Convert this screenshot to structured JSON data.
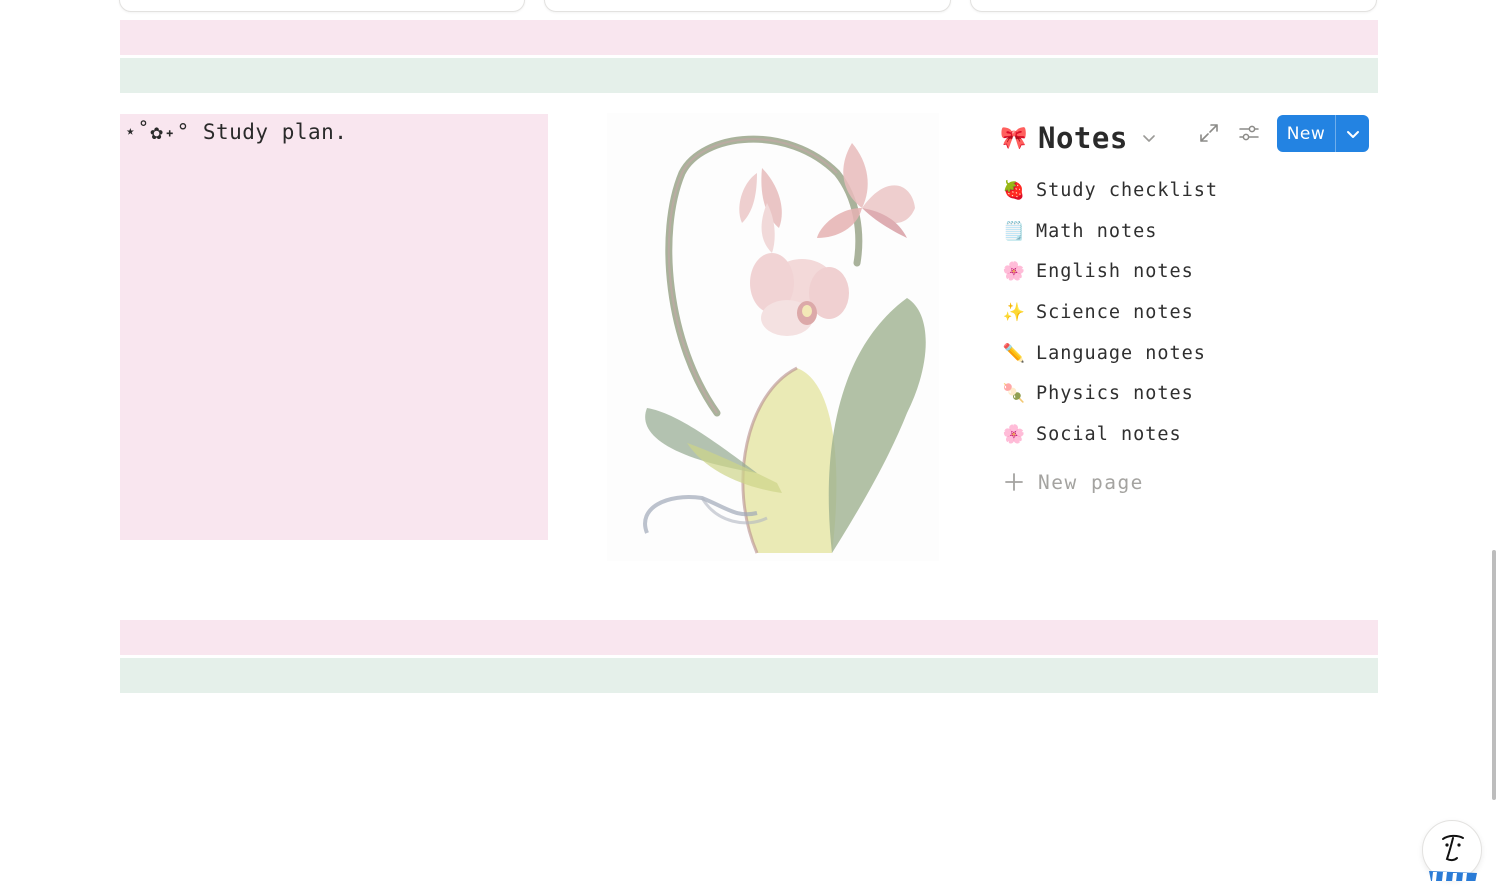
{
  "plan": {
    "title": "⋆˚✿˖° Study plan."
  },
  "notes": {
    "emoji": "🎀",
    "title": "Notes",
    "new_button_label": "New",
    "items": [
      {
        "emoji": "🍓",
        "label": "Study checklist"
      },
      {
        "emoji": "🗒️",
        "label": "Math notes"
      },
      {
        "emoji": "🌸",
        "label": "English notes"
      },
      {
        "emoji": "✨",
        "label": "Science notes"
      },
      {
        "emoji": "✏️",
        "label": "Language notes"
      },
      {
        "emoji": "🍡",
        "label": "Physics notes"
      },
      {
        "emoji": "🌸",
        "label": "Social notes"
      }
    ],
    "new_page_label": "New page"
  },
  "colors": {
    "pink_band": "#f9e6ef",
    "green_band": "#e5f0ea",
    "accent_blue": "#2383e2"
  },
  "icons": {
    "expand": "expand-arrows-icon",
    "filter": "sliders-icon",
    "chevron": "chevron-down-icon",
    "plus": "plus-icon"
  }
}
